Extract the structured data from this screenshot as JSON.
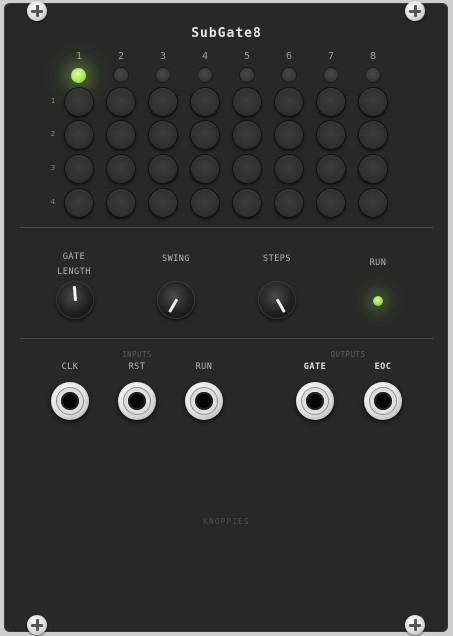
{
  "module": {
    "title": "SubGate8",
    "brand": "KNOPPIES"
  },
  "grid": {
    "columns": [
      "1",
      "2",
      "3",
      "4",
      "5",
      "6",
      "7",
      "8"
    ],
    "rows": [
      "1",
      "2",
      "3",
      "4"
    ],
    "active_step": 1
  },
  "controls": {
    "gate_length_line1": "GATE",
    "gate_length_line2": "LENGTH",
    "swing": "SWING",
    "steps": "STEPS",
    "run": "RUN"
  },
  "io": {
    "inputs_heading": "INPUTS",
    "outputs_heading": "OUTPUTS",
    "clk": "CLK",
    "rst": "RST",
    "run": "RUN",
    "gate": "GATE",
    "eoc": "EOC"
  },
  "colors": {
    "panel": "#282828",
    "led_active": "#9ede4e",
    "led_inactive": "#2f2f2f",
    "knob_pointer": "#f2f2f2"
  }
}
